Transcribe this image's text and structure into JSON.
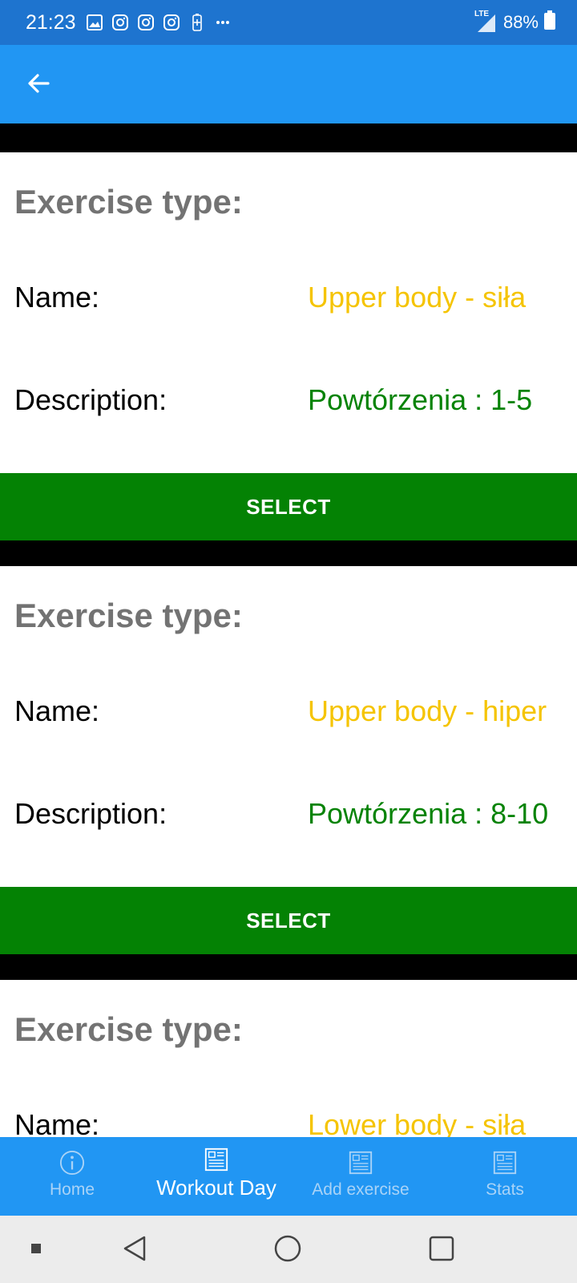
{
  "status": {
    "time": "21:23",
    "network": "LTE",
    "battery": "88%",
    "icons": [
      "gallery-icon",
      "instagram-icon",
      "instagram-icon",
      "instagram-icon",
      "battery-saver-icon",
      "more-dots-icon"
    ]
  },
  "appbar": {
    "back_icon": "arrow-left-icon"
  },
  "cards": [
    {
      "type_label": "Exercise type:",
      "name_label": "Name:",
      "name_value": "Upper body - siła",
      "desc_label": "Description:",
      "desc_value": "Powtórzenia : 1-5",
      "button": "SELECT"
    },
    {
      "type_label": "Exercise type:",
      "name_label": "Name:",
      "name_value": "Upper body - hiper",
      "desc_label": "Description:",
      "desc_value": "Powtórzenia : 8-10",
      "button": "SELECT"
    },
    {
      "type_label": "Exercise type:",
      "name_label": "Name:",
      "name_value": "Lower body - siła"
    }
  ],
  "bottom_nav": [
    {
      "label": "Home",
      "icon": "info-icon",
      "active": false
    },
    {
      "label": "Workout Day",
      "icon": "document-icon",
      "active": true
    },
    {
      "label": "Add exercise",
      "icon": "document-icon",
      "active": false
    },
    {
      "label": "Stats",
      "icon": "document-icon",
      "active": false
    }
  ],
  "colors": {
    "statusbar": "#1e74cf",
    "appbar": "#2196f3",
    "name_value": "#f5c400",
    "desc_value": "#068306",
    "select_button": "#048204",
    "type_label": "#737373"
  }
}
